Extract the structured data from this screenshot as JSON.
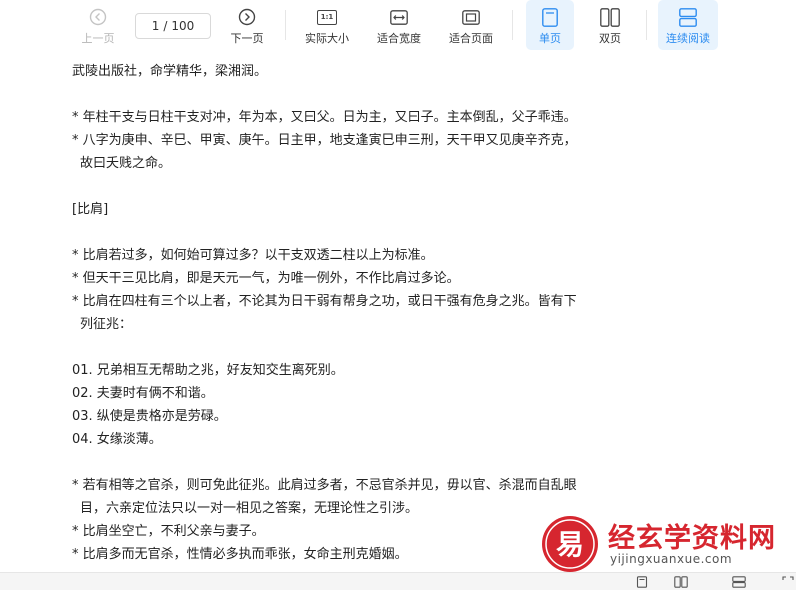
{
  "toolbar": {
    "prev_label": "上一页",
    "page_current": "1",
    "page_sep": "/",
    "page_total": "100",
    "next_label": "下一页",
    "actual_size_label": "实际大小",
    "actual_size_icon_text": "1:1",
    "fit_width_label": "适合宽度",
    "fit_page_label": "适合页面",
    "single_page_label": "单页",
    "double_page_label": "双页",
    "continuous_label": "连续阅读",
    "accent_color": "#2d8cf0"
  },
  "content": {
    "lines": [
      {
        "text": "武陵出版社，命学精华，梁湘润。",
        "indent": false
      },
      {
        "text": "",
        "indent": false
      },
      {
        "text": "* 年柱干支与日柱干支对冲，年为本，又曰父。日为主，又曰子。主本倒乱，父子乖违。",
        "indent": false
      },
      {
        "text": "* 八字为庚申、辛巳、甲寅、庚午。日主甲，地支逢寅巳申三刑，天干甲又见庚辛齐克，",
        "indent": false
      },
      {
        "text": "故曰夭贱之命。",
        "indent": true
      },
      {
        "text": "",
        "indent": false
      },
      {
        "text": "[比肩]",
        "indent": false
      },
      {
        "text": "",
        "indent": false
      },
      {
        "text": "* 比肩若过多，如何始可算过多？以干支双透二柱以上为标准。",
        "indent": false
      },
      {
        "text": "* 但天干三见比肩，即是天元一气，为唯一例外，不作比肩过多论。",
        "indent": false
      },
      {
        "text": "* 比肩在四柱有三个以上者，不论其为日干弱有帮身之功，或日干强有危身之兆。皆有下",
        "indent": false
      },
      {
        "text": "列征兆：",
        "indent": true
      },
      {
        "text": "",
        "indent": false
      },
      {
        "text": "01. 兄弟相互无帮助之兆，好友知交生离死别。",
        "indent": false
      },
      {
        "text": "02. 夫妻时有俩不和谐。",
        "indent": false
      },
      {
        "text": "03. 纵使是贵格亦是劳碌。",
        "indent": false
      },
      {
        "text": "04. 女缘淡薄。",
        "indent": false
      },
      {
        "text": "",
        "indent": false
      },
      {
        "text": "* 若有相等之官杀，则可免此征兆。此肩过多者，不忌官杀并见，毋以官、杀混而自乱眼",
        "indent": false
      },
      {
        "text": "目，六亲定位法只以一对一相见之答案，无理论性之引涉。",
        "indent": true
      },
      {
        "text": "* 比肩坐空亡，不利父亲与妻子。",
        "indent": false
      },
      {
        "text": "* 比肩多而无官杀，性情必多执而乖张，女命主刑克婚姻。",
        "indent": false
      }
    ]
  },
  "watermark": {
    "title": "经玄学资料网",
    "url": "yijingxuanxue.com",
    "logo_glyph": "易",
    "color": "#d6262f"
  }
}
